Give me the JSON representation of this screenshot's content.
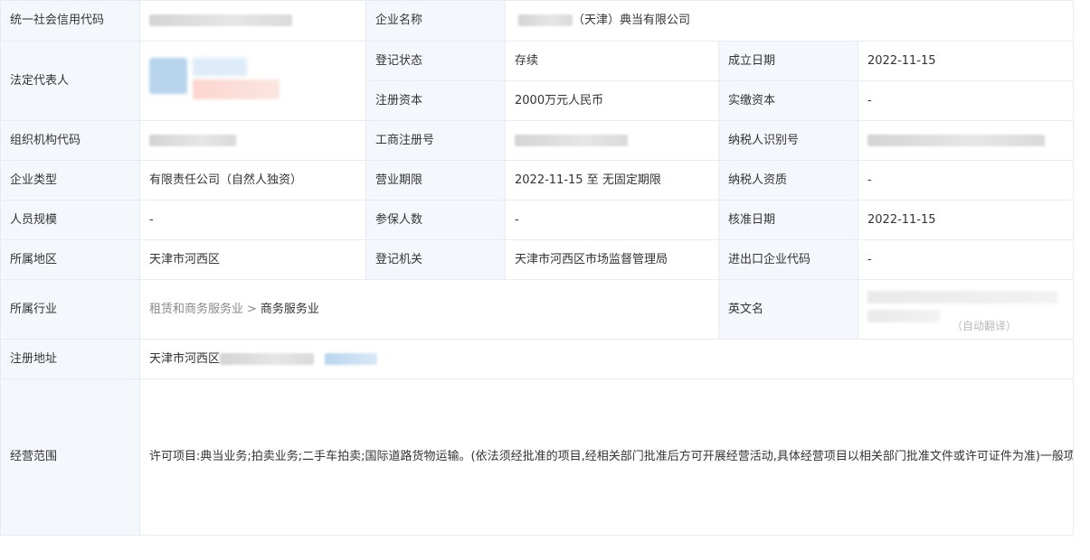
{
  "rows": {
    "credit_code": {
      "label": "统一社会信用代码"
    },
    "company_name": {
      "label": "企业名称",
      "value": "（天津）典当有限公司"
    },
    "legal_rep": {
      "label": "法定代表人"
    },
    "reg_status": {
      "label": "登记状态",
      "value": "存续"
    },
    "est_date": {
      "label": "成立日期",
      "value": "2022-11-15"
    },
    "reg_capital": {
      "label": "注册资本",
      "value": "2000万元人民币"
    },
    "paid_capital": {
      "label": "实缴资本",
      "value": "-"
    },
    "org_code": {
      "label": "组织机构代码"
    },
    "biz_reg_no": {
      "label": "工商注册号"
    },
    "taxpayer_id": {
      "label": "纳税人识别号"
    },
    "company_type": {
      "label": "企业类型",
      "value": "有限责任公司（自然人独资）"
    },
    "biz_term": {
      "label": "营业期限",
      "value": "2022-11-15 至 无固定期限"
    },
    "taxpayer_qual": {
      "label": "纳税人资质",
      "value": "-"
    },
    "staff_size": {
      "label": "人员规模",
      "value": "-"
    },
    "insured_count": {
      "label": "参保人数",
      "value": "-"
    },
    "approval_date": {
      "label": "核准日期",
      "value": "2022-11-15"
    },
    "region": {
      "label": "所属地区",
      "value": "天津市河西区"
    },
    "reg_authority": {
      "label": "登记机关",
      "value": "天津市河西区市场监督管理局"
    },
    "import_export_code": {
      "label": "进出口企业代码",
      "value": "-"
    },
    "industry": {
      "label": "所属行业",
      "parent": "租赁和商务服务业",
      "separator": ">",
      "child": "商务服务业"
    },
    "english_name": {
      "label": "英文名",
      "partial_tail": "（自动翻译）"
    },
    "reg_address": {
      "label": "注册地址",
      "value": "天津市河西区"
    },
    "biz_scope": {
      "label": "经营范围",
      "value": "许可项目:典当业务;拍卖业务;二手车拍卖;国际道路货物运输。(依法须经批准的项目,经相关部门批准后方可开展经营活动,具体经营项目以相关部门批准文件或许可证件为准)一般项目:金银制品销售;二手车经纪;有色金属合金销售;珠宝首饰批发;小微型客车租赁经营服务;机械设备租赁;办公设备租赁服务;非居住房地产租赁;互联网销售(除销售需要许可的商品);集装箱租赁服务;计算机及通讯设备租赁;新能源汽车生产测试设备销售;电力电子元器件销售;会议及展览服务;企业管理咨询;商务代理代办服务;农业机械租赁;运输设备租赁服务;不动产登记代理服务;专业保洁、清洗、消毒服务;租赁服务(不含许可类租赁服务);仓储设备租赁服务;国内货物运输代理;信息咨询服务(不含许可类信息咨询服务);工程管理服务;技术服务、技术开发、技术咨询、技术交流、技术转让、技术推广;办公用品销售;汽车零配件零售;橡胶制品销售;汽车拖车、求援、清障服务;停车场服务;电车销售;轴承、齿轮和传动部件销售;新能源汽车整车销售;新能源汽车换电设施销售;新能源汽车电附件销售。(除依法须经批准的项目外,凭营业执照依法自主开展经营活动)"
    }
  },
  "colors": {
    "label_bg": "#f4f8fc",
    "border": "#e7ecf2",
    "text": "#333333",
    "muted": "#888888"
  }
}
